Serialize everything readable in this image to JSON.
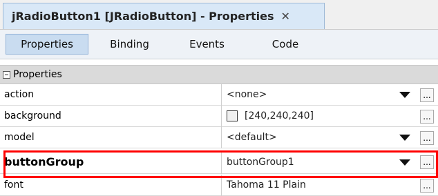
{
  "tab": {
    "title": "jRadioButton1 [JRadioButton] - Properties",
    "close_icon": "✕"
  },
  "subtabs": [
    "Properties",
    "Binding",
    "Events",
    "Code"
  ],
  "group": {
    "label": "Properties",
    "icon": "collapse-icon"
  },
  "rows": [
    {
      "name": "action",
      "value": "<none>",
      "dropdown": true,
      "ellipsis": true
    },
    {
      "name": "background",
      "value": "[240,240,240]",
      "color_swatch": "#f0f0f0",
      "dropdown": false,
      "ellipsis": true
    },
    {
      "name": "model",
      "value": "<default>",
      "dropdown": true,
      "ellipsis": true
    },
    {
      "name": "buttonGroup",
      "value": "buttonGroup1",
      "dropdown": true,
      "ellipsis": true,
      "highlighted": true
    },
    {
      "name": "font",
      "value": "Tahoma 11 Plain",
      "dropdown": false,
      "ellipsis": true
    }
  ],
  "ellipsis_label": "...",
  "colors": {
    "highlight": "#ff0000",
    "tab_bg": "#d9e8f7",
    "subtab_active_bg": "#c9dcf0"
  }
}
